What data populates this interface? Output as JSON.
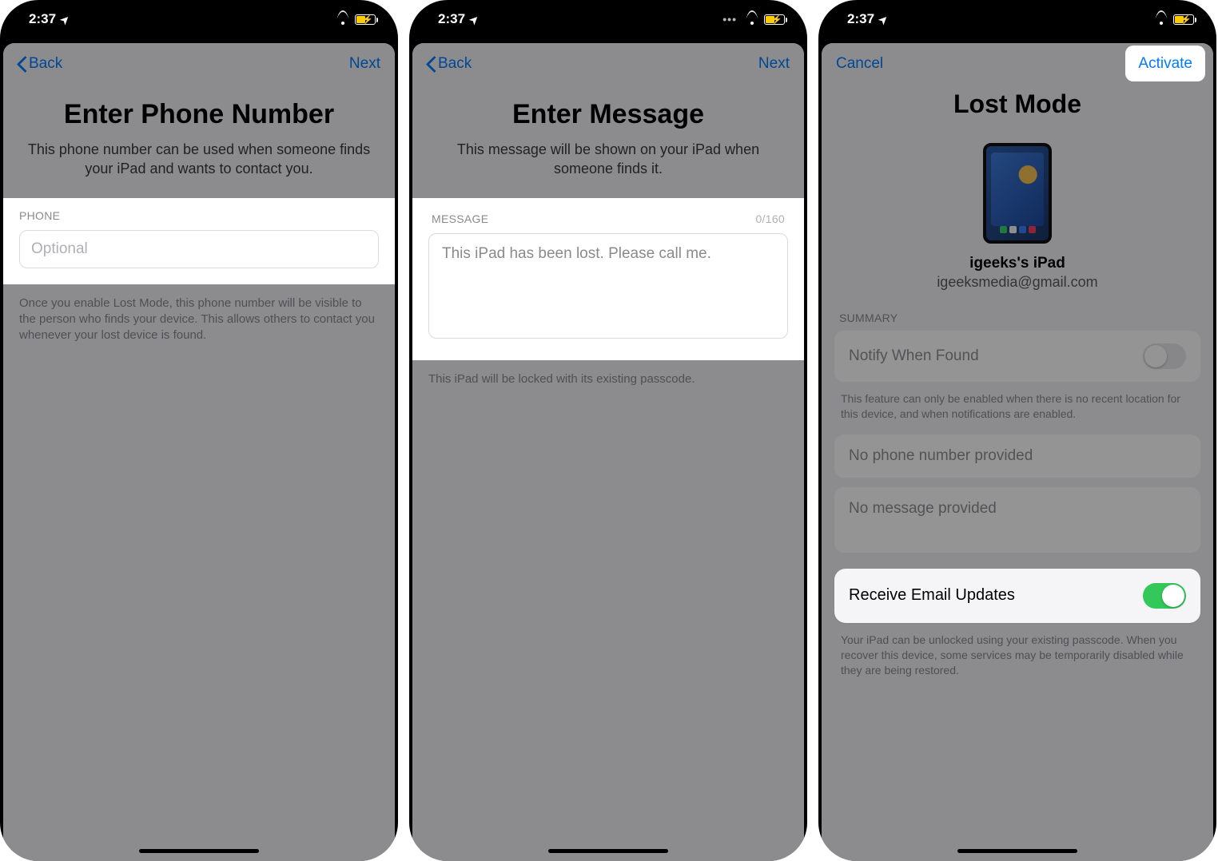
{
  "status": {
    "time": "2:37"
  },
  "screen1": {
    "back": "Back",
    "next": "Next",
    "title": "Enter Phone Number",
    "subtitle": "This phone number can be used when someone finds your iPad and wants to contact you.",
    "field_label": "PHONE",
    "placeholder": "Optional",
    "footer": "Once you enable Lost Mode, this phone number will be visible to the person who finds your device. This allows others to contact you whenever your lost device is found."
  },
  "screen2": {
    "back": "Back",
    "next": "Next",
    "title": "Enter Message",
    "subtitle": "This message will be shown on your iPad when someone finds it.",
    "field_label": "MESSAGE",
    "counter": "0/160",
    "message_value": "This iPad has been lost. Please call me.",
    "footer": "This iPad will be locked with its existing passcode."
  },
  "screen3": {
    "cancel": "Cancel",
    "activate": "Activate",
    "title": "Lost Mode",
    "device_name": "igeeks's iPad",
    "device_email": "igeeksmedia@gmail.com",
    "summary_label": "SUMMARY",
    "notify_label": "Notify When Found",
    "notify_hint": "This feature can only be enabled when there is no recent location for this device, and when notifications are enabled.",
    "no_phone": "No phone number provided",
    "no_message": "No message provided",
    "email_updates": "Receive Email Updates",
    "unlock_hint": "Your iPad can be unlocked using your existing passcode. When you recover this device, some services may be temporarily disabled while they are being restored."
  }
}
